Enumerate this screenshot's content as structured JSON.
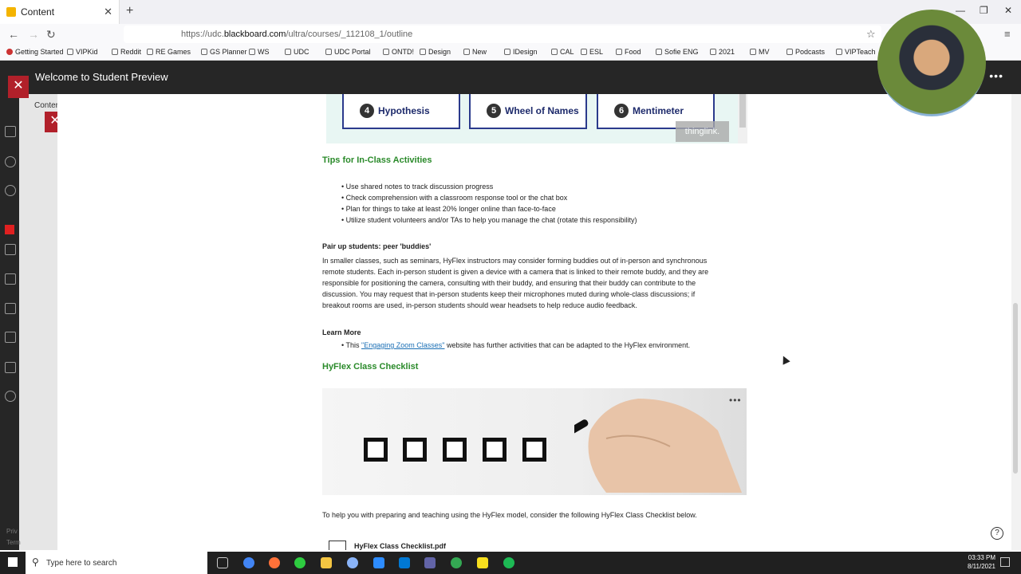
{
  "browser": {
    "tab_title": "Content",
    "url_prefix": "https://udc.",
    "url_domain": "blackboard.com",
    "url_path": "/ultra/courses/_112108_1/outline",
    "bookmarks": [
      "Getting Started",
      "VIPKid",
      "Reddit",
      "RE Games",
      "GS Planner",
      "WS",
      "UDC",
      "UDC Portal",
      "ONTD!",
      "Design",
      "New",
      "IDesign",
      "CAL",
      "ESL",
      "Food",
      "Sofie ENG",
      "2021",
      "MV",
      "Podcasts",
      "VIPTeach"
    ]
  },
  "preview": {
    "title": "Welcome to Student Preview"
  },
  "rail": {
    "content_label": "Conter",
    "privacy": "Priv",
    "terms": "Term"
  },
  "embed": {
    "tiles": [
      {
        "num": "4",
        "label": "Hypothesis"
      },
      {
        "num": "5",
        "label": "Wheel of Names"
      },
      {
        "num": "6",
        "label": "Mentimeter"
      }
    ],
    "badge": "thinglink."
  },
  "tips": {
    "heading": "Tips for In-Class Activities",
    "items": [
      "Use shared notes to track discussion progress",
      "Check comprehension with a classroom response tool or the chat box",
      "Plan for things to take at least 20% longer online than face-to-face",
      "Utilize student volunteers and/or TAs to help you manage the chat (rotate this responsibility)"
    ]
  },
  "pairup": {
    "heading": "Pair up students: peer 'buddies'",
    "lines": [
      "In smaller classes, such as seminars, HyFlex instructors may consider forming buddies out of in-person and synchronous",
      "remote students. Each in-person student is given a device with a camera that is linked to their remote buddy, and they are",
      "responsible for positioning the camera, consulting with their buddy, and ensuring that their buddy can contribute to the",
      "discussion. You may request that in-person students keep their microphones muted during whole-class discussions; if",
      "breakout rooms are used, in-person students should wear headsets to help reduce audio feedback."
    ]
  },
  "learnmore": {
    "heading": "Learn More",
    "prefix": "This ",
    "link": "\"Engaging Zoom Classes\"",
    "suffix": " website has further activities that can be adapted to the HyFlex environment."
  },
  "checklist": {
    "heading": "HyFlex Class Checklist",
    "intro": "To help you with preparing and teaching using the HyFlex model, consider the following HyFlex Class Checklist below.",
    "pdf_name": "HyFlex Class Checklist.pdf"
  },
  "taskbar": {
    "search_placeholder": "Type here to search",
    "time": "03:33 PM",
    "date": "8/11/2021"
  }
}
